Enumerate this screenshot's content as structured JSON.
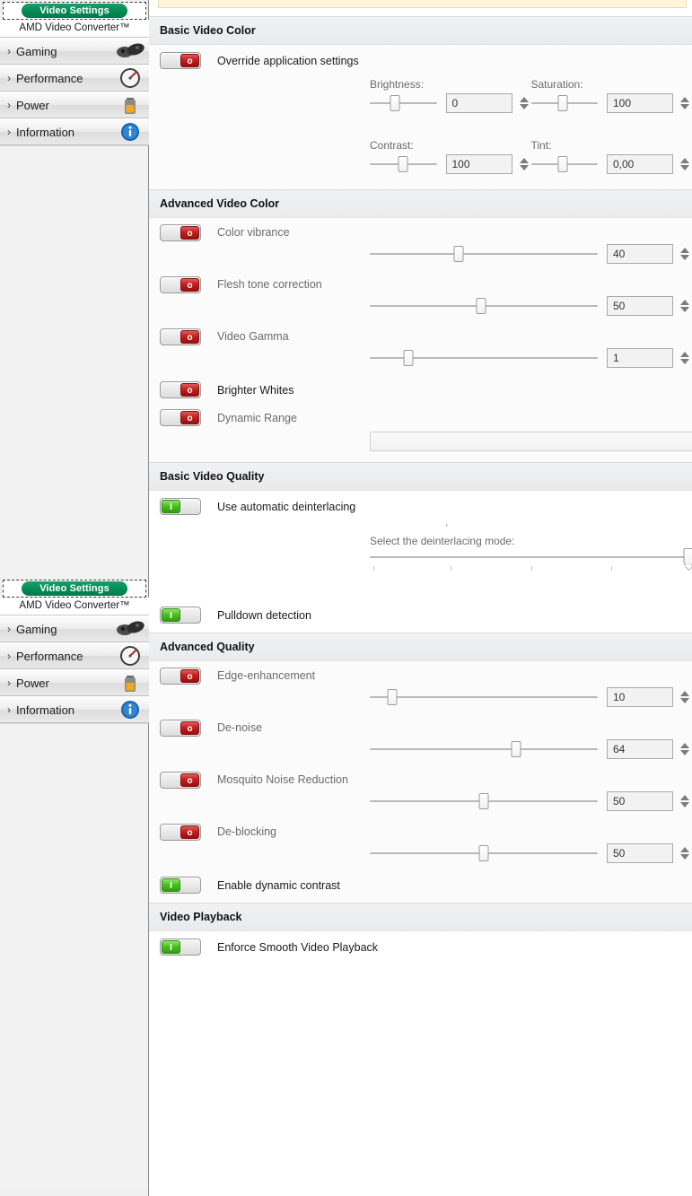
{
  "sidebar": {
    "tab_label": "Video Settings",
    "subtitle": "AMD Video Converter™",
    "items": [
      {
        "label": "Gaming",
        "icon": "gamepad-icon"
      },
      {
        "label": "Performance",
        "icon": "gauge-icon"
      },
      {
        "label": "Power",
        "icon": "battery-icon"
      },
      {
        "label": "Information",
        "icon": "info-icon"
      }
    ]
  },
  "sections": [
    {
      "id": "basic-video-color",
      "title": "Basic Video Color",
      "toggle": {
        "label": "Override application settings",
        "state": "off",
        "glyph": "o",
        "label_tone": "strong"
      },
      "fields": [
        {
          "label": "Brightness:",
          "value": "0",
          "pos": 38
        },
        {
          "label": "Saturation:",
          "value": "100",
          "pos": 48
        },
        {
          "label": "Contrast:",
          "value": "100",
          "pos": 50
        },
        {
          "label": "Tint:",
          "value": "0,00",
          "pos": 48
        }
      ]
    },
    {
      "id": "advanced-video-color",
      "title": "Advanced Video Color",
      "rows": [
        {
          "label": "Color vibrance",
          "state": "off",
          "glyph": "o",
          "value": "40",
          "pos": 39,
          "has_slider": true
        },
        {
          "label": "Flesh tone correction",
          "state": "off",
          "glyph": "o",
          "value": "50",
          "pos": 49,
          "has_slider": true
        },
        {
          "label": "Video Gamma",
          "state": "off",
          "glyph": "o",
          "value": "1",
          "pos": 17,
          "has_slider": true
        },
        {
          "label": "Brighter Whites",
          "state": "off",
          "glyph": "o",
          "has_slider": false,
          "label_tone": "strong"
        },
        {
          "label": "Dynamic Range",
          "state": "off",
          "glyph": "o",
          "has_slider": false,
          "has_combo": true,
          "combo_value": ""
        }
      ]
    },
    {
      "id": "basic-video-quality",
      "title": "Basic Video Quality",
      "rows": [
        {
          "label": "Use automatic deinterlacing",
          "state": "on",
          "glyph": "I",
          "label_tone": "strong"
        },
        {
          "label": "Pulldown detection",
          "state": "on",
          "glyph": "I",
          "label_tone": "strong"
        }
      ],
      "deinterlace": {
        "label": "Select the deinterlacing mode:",
        "pos": 100,
        "ticks": 5,
        "marker": "."
      }
    },
    {
      "id": "advanced-quality",
      "title": "Advanced Quality",
      "rows": [
        {
          "label": "Edge-enhancement",
          "state": "off",
          "glyph": "o",
          "value": "10",
          "pos": 10,
          "has_slider": true
        },
        {
          "label": "De-noise",
          "state": "off",
          "glyph": "o",
          "value": "64",
          "pos": 64,
          "has_slider": true
        },
        {
          "label": "Mosquito Noise Reduction",
          "state": "off",
          "glyph": "o",
          "value": "50",
          "pos": 50,
          "has_slider": true
        },
        {
          "label": "De-blocking",
          "state": "off",
          "glyph": "o",
          "value": "50",
          "pos": 50,
          "has_slider": true
        },
        {
          "label": "Enable dynamic contrast",
          "state": "on",
          "glyph": "I",
          "has_slider": false,
          "label_tone": "strong"
        }
      ]
    },
    {
      "id": "video-playback",
      "title": "Video Playback",
      "rows": [
        {
          "label": "Enforce Smooth Video Playback",
          "state": "on",
          "glyph": "I",
          "has_slider": false,
          "label_tone": "strong"
        }
      ]
    }
  ],
  "colors": {
    "accent_green": "#068a56",
    "toggle_off_red": "#c11f1f",
    "toggle_on_green": "#4cc220",
    "notice_bg": "#fdf6dd"
  }
}
